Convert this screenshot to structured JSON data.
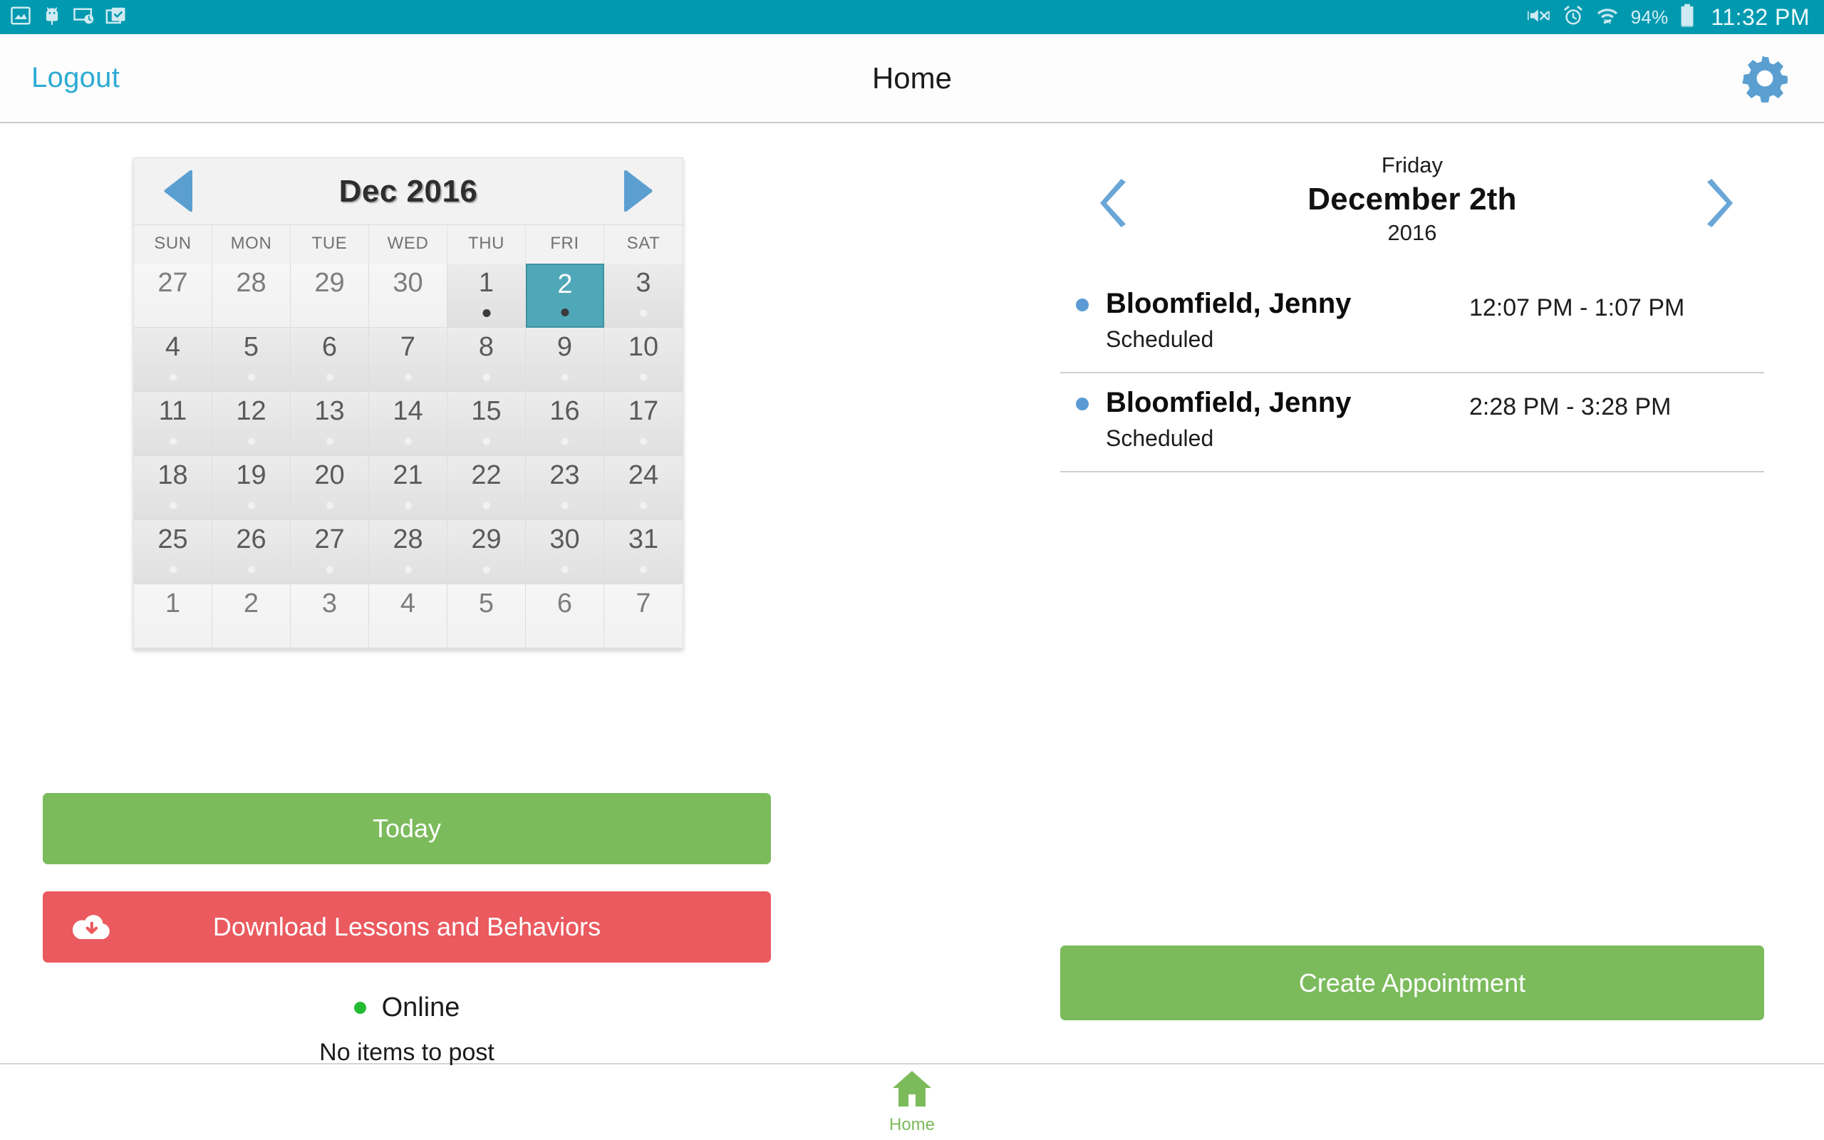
{
  "statusbar": {
    "left_icons": [
      "image-icon",
      "android-bug-icon",
      "screen-clock-icon",
      "checked-bag-icon"
    ],
    "right_icons": [
      "mute-vibrate-icon",
      "alarm-clock-icon",
      "wifi-data-icon",
      "battery-icon"
    ],
    "battery_percent": "94%",
    "clock": "11:32 PM",
    "bg_color": "#0099b0"
  },
  "appbar": {
    "logout_label": "Logout",
    "title": "Home",
    "settings_icon": "gear-icon",
    "accent_color": "#2cabd4"
  },
  "calendar": {
    "month_label": "Dec 2016",
    "prev_icon": "triangle-left-icon",
    "next_icon": "triangle-right-icon",
    "dow": [
      "SUN",
      "MON",
      "TUE",
      "WED",
      "THU",
      "FRI",
      "SAT"
    ],
    "selected_color": "#4fa8b8",
    "weeks": [
      [
        {
          "day": "27",
          "month": "other",
          "dot": "none"
        },
        {
          "day": "28",
          "month": "other",
          "dot": "none"
        },
        {
          "day": "29",
          "month": "other",
          "dot": "none"
        },
        {
          "day": "30",
          "month": "other",
          "dot": "none"
        },
        {
          "day": "1",
          "month": "current",
          "dot": "event"
        },
        {
          "day": "2",
          "month": "current",
          "dot": "event",
          "selected": true
        },
        {
          "day": "3",
          "month": "current",
          "dot": "empty"
        }
      ],
      [
        {
          "day": "4",
          "month": "current",
          "dot": "empty"
        },
        {
          "day": "5",
          "month": "current",
          "dot": "empty"
        },
        {
          "day": "6",
          "month": "current",
          "dot": "empty"
        },
        {
          "day": "7",
          "month": "current",
          "dot": "empty"
        },
        {
          "day": "8",
          "month": "current",
          "dot": "empty"
        },
        {
          "day": "9",
          "month": "current",
          "dot": "empty"
        },
        {
          "day": "10",
          "month": "current",
          "dot": "empty"
        }
      ],
      [
        {
          "day": "11",
          "month": "current",
          "dot": "empty"
        },
        {
          "day": "12",
          "month": "current",
          "dot": "empty"
        },
        {
          "day": "13",
          "month": "current",
          "dot": "empty"
        },
        {
          "day": "14",
          "month": "current",
          "dot": "empty"
        },
        {
          "day": "15",
          "month": "current",
          "dot": "empty"
        },
        {
          "day": "16",
          "month": "current",
          "dot": "empty"
        },
        {
          "day": "17",
          "month": "current",
          "dot": "empty"
        }
      ],
      [
        {
          "day": "18",
          "month": "current",
          "dot": "empty"
        },
        {
          "day": "19",
          "month": "current",
          "dot": "empty"
        },
        {
          "day": "20",
          "month": "current",
          "dot": "empty"
        },
        {
          "day": "21",
          "month": "current",
          "dot": "empty"
        },
        {
          "day": "22",
          "month": "current",
          "dot": "empty"
        },
        {
          "day": "23",
          "month": "current",
          "dot": "empty"
        },
        {
          "day": "24",
          "month": "current",
          "dot": "empty"
        }
      ],
      [
        {
          "day": "25",
          "month": "current",
          "dot": "empty"
        },
        {
          "day": "26",
          "month": "current",
          "dot": "empty"
        },
        {
          "day": "27",
          "month": "current",
          "dot": "empty"
        },
        {
          "day": "28",
          "month": "current",
          "dot": "empty"
        },
        {
          "day": "29",
          "month": "current",
          "dot": "empty"
        },
        {
          "day": "30",
          "month": "current",
          "dot": "empty"
        },
        {
          "day": "31",
          "month": "current",
          "dot": "empty"
        }
      ],
      [
        {
          "day": "1",
          "month": "other",
          "dot": "none"
        },
        {
          "day": "2",
          "month": "other",
          "dot": "none"
        },
        {
          "day": "3",
          "month": "other",
          "dot": "none"
        },
        {
          "day": "4",
          "month": "other",
          "dot": "none"
        },
        {
          "day": "5",
          "month": "other",
          "dot": "none"
        },
        {
          "day": "6",
          "month": "other",
          "dot": "none"
        },
        {
          "day": "7",
          "month": "other",
          "dot": "none"
        }
      ]
    ]
  },
  "left_actions": {
    "today_label": "Today",
    "download_label": "Download Lessons and Behaviors",
    "download_icon": "cloud-download-icon",
    "today_color": "#7cbb5c",
    "download_color": "#ea5a5f",
    "online_label": "Online",
    "online_color": "#22bb33",
    "no_items_label": "No items to post"
  },
  "day_panel": {
    "weekday": "Friday",
    "date": "December 2th",
    "year": "2016",
    "prev_icon": "chevron-left-icon",
    "next_icon": "chevron-right-icon",
    "appointments": [
      {
        "name": "Bloomfield, Jenny",
        "status": "Scheduled",
        "time": "12:07 PM - 1:07 PM",
        "bullet_color": "#5b9bd5"
      },
      {
        "name": "Bloomfield, Jenny",
        "status": "Scheduled",
        "time": "2:28 PM - 3:28 PM",
        "bullet_color": "#5b9bd5"
      }
    ],
    "create_label": "Create Appointment",
    "create_color": "#7cbb5c"
  },
  "bottomnav": {
    "items": [
      {
        "label": "Home",
        "icon": "home-icon",
        "active": true
      }
    ],
    "active_color": "#7cbb5c"
  }
}
